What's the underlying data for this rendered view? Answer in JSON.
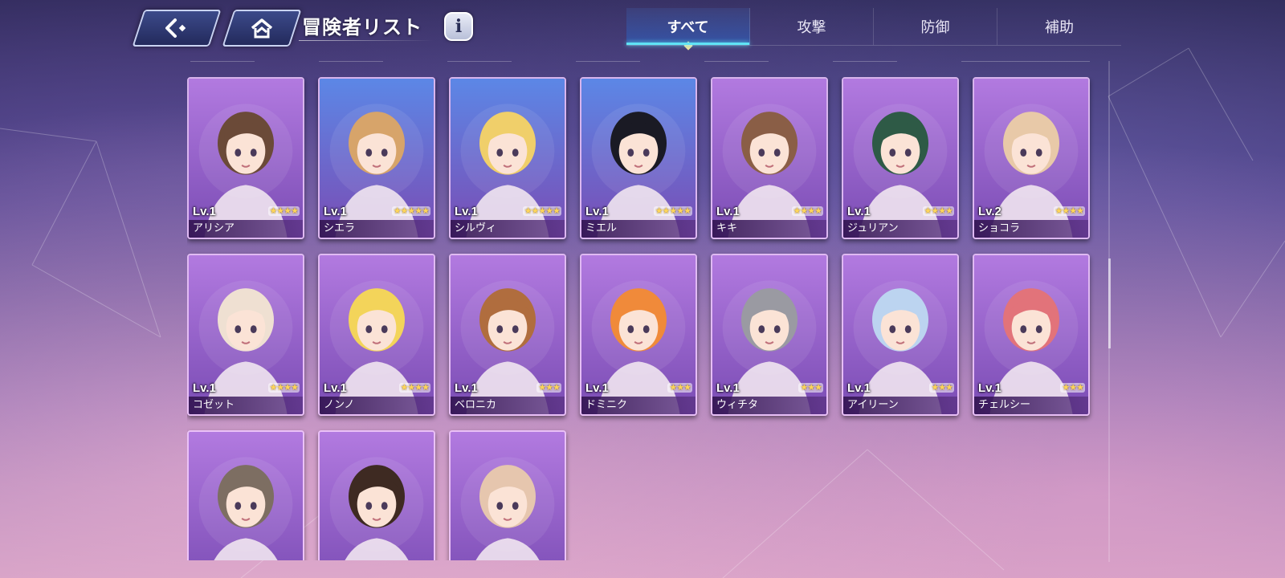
{
  "header": {
    "title": "冒険者リスト",
    "back_icon": "back-arrow-icon",
    "home_icon": "home-icon",
    "info_label": "i"
  },
  "tabs": [
    {
      "label": "すべて",
      "active": true
    },
    {
      "label": "攻撃",
      "active": false
    },
    {
      "label": "防御",
      "active": false
    },
    {
      "label": "補助",
      "active": false
    }
  ],
  "adventurers": [
    {
      "level": "Lv.1",
      "name": "アリシア",
      "stars": "★★★★",
      "frame": "purple",
      "hair": "#6b4a38"
    },
    {
      "level": "Lv.1",
      "name": "シエラ",
      "stars": "★★★★★",
      "frame": "blue",
      "hair": "#d7a46a"
    },
    {
      "level": "Lv.1",
      "name": "シルヴィ",
      "stars": "★★★★★",
      "frame": "blue",
      "hair": "#f0cf6a"
    },
    {
      "level": "Lv.1",
      "name": "ミエル",
      "stars": "★★★★★",
      "frame": "blue",
      "hair": "#1a1a24"
    },
    {
      "level": "Lv.1",
      "name": "キキ",
      "stars": "★★★★",
      "frame": "purple",
      "hair": "#8a5e46"
    },
    {
      "level": "Lv.1",
      "name": "ジュリアン",
      "stars": "★★★★",
      "frame": "purple",
      "hair": "#2e5a46"
    },
    {
      "level": "Lv.2",
      "name": "ショコラ",
      "stars": "★★★★",
      "frame": "purple",
      "hair": "#e8c9a8"
    },
    {
      "level": "Lv.1",
      "name": "コゼット",
      "stars": "★★★★",
      "frame": "purple",
      "hair": "#efe0d2"
    },
    {
      "level": "Lv.1",
      "name": "ノンノ",
      "stars": "★★★★",
      "frame": "purple",
      "hair": "#f3d45a"
    },
    {
      "level": "Lv.1",
      "name": "ベロニカ",
      "stars": "★★★",
      "frame": "purple",
      "hair": "#b06d3e"
    },
    {
      "level": "Lv.1",
      "name": "ドミニク",
      "stars": "★★★",
      "frame": "purple",
      "hair": "#f08a3a"
    },
    {
      "level": "Lv.1",
      "name": "ウィチタ",
      "stars": "★★★",
      "frame": "purple",
      "hair": "#9a9aa2"
    },
    {
      "level": "Lv.1",
      "name": "アイリーン",
      "stars": "★★★",
      "frame": "purple",
      "hair": "#bcd4f0"
    },
    {
      "level": "Lv.1",
      "name": "チェルシー",
      "stars": "★★★",
      "frame": "purple",
      "hair": "#e2737a"
    },
    {
      "level": "",
      "name": "",
      "stars": "",
      "frame": "purple",
      "hair": "#7d6e62"
    },
    {
      "level": "",
      "name": "",
      "stars": "",
      "frame": "purple",
      "hair": "#3e2a22"
    },
    {
      "level": "",
      "name": "",
      "stars": "",
      "frame": "purple",
      "hair": "#e6c6ae"
    }
  ],
  "colors": {
    "purple_frame": "#b27ae0",
    "blue_frame": "#5c87e6",
    "accent": "#5fe3f5",
    "star": "#ffd65a"
  }
}
